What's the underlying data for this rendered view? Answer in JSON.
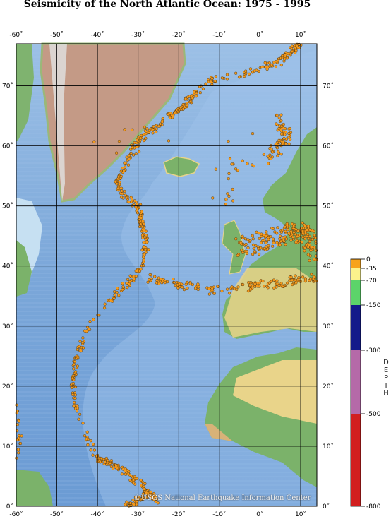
{
  "title": "Seismicity of the North Atlantic Ocean: 1975 - 1995",
  "credit": "©USGS National Earthquake Information Center",
  "lon_labels": [
    "-60˚",
    "-50˚",
    "-40˚",
    "-30˚",
    "-20˚",
    "-10˚",
    "0˚",
    "10˚"
  ],
  "lat_labels": [
    "0˚",
    "10˚",
    "20˚",
    "30˚",
    "40˚",
    "50˚",
    "60˚",
    "70˚"
  ],
  "map_extent": {
    "lon_min": -60,
    "lon_max": 14,
    "lat_min": 0,
    "lat_max": 77
  },
  "legend": {
    "title_letters": [
      "D",
      "E",
      "P",
      "T",
      "H"
    ],
    "ticks": [
      "0",
      "-35",
      "-70",
      "-150",
      "-300",
      "-500",
      "-800"
    ],
    "colors": [
      "#f7a21b",
      "#fbf28c",
      "#5cd46a",
      "#131a8a",
      "#b56aa8",
      "#d21f1f"
    ]
  },
  "colors": {
    "ocean_deep": "#7aa6d8",
    "ocean_shelf": "#b9d9ef",
    "land_green": "#7bb26a",
    "land_yellow": "#e9d48a",
    "greenland": "#c49a86",
    "quake_fill": "#f59a1c"
  }
}
